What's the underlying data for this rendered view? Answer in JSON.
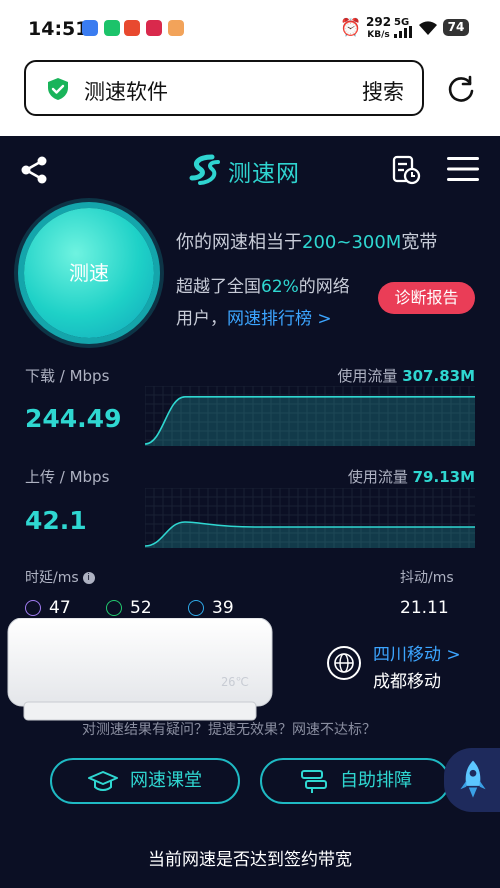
{
  "status": {
    "time": "14:51",
    "net_speed": "292",
    "net_unit": "KB/s",
    "net_type": "5G",
    "battery": "74"
  },
  "urlbar": {
    "text": "测速软件",
    "search_label": "搜索"
  },
  "app": {
    "title": "测速网"
  },
  "speedtest": {
    "button_label": "测速",
    "summary_prefix": "你的网速相当于",
    "summary_value": "200~300M",
    "summary_suffix": "宽带",
    "exceed_prefix": "超越了全国",
    "exceed_percent": "62%",
    "exceed_suffix": "的网络",
    "users_prefix": "用户，",
    "rank_link": "网速排行榜 >",
    "diagnose_label": "诊断报告"
  },
  "download": {
    "label": "下载 / Mbps",
    "usage_label": "使用流量",
    "usage_value": "307.83M",
    "value": "244.49",
    "curve_level": 0.82
  },
  "upload": {
    "label": "上传 / Mbps",
    "usage_label": "使用流量",
    "usage_value": "79.13M",
    "value": "42.1",
    "curve_level": 0.35
  },
  "latency": {
    "label": "时延/ms",
    "ping": "47",
    "down": "52",
    "up": "39"
  },
  "jitter": {
    "label": "抖动/ms",
    "value": "21.11"
  },
  "ad": {
    "display": "26℃"
  },
  "carrier": {
    "name": "四川移动 >",
    "city": "成都移动"
  },
  "question": "对测速结果有疑问？提速无效果？网速不达标？",
  "buttons": {
    "classroom": "网速课堂",
    "self_help": "自助排障"
  },
  "bottom_question": "当前网速是否达到签约带宽",
  "colors": {
    "accent": "#2fd7d1",
    "link": "#3ca5ff",
    "background": "#0b0f24",
    "diagnose": "#ea3d57"
  }
}
